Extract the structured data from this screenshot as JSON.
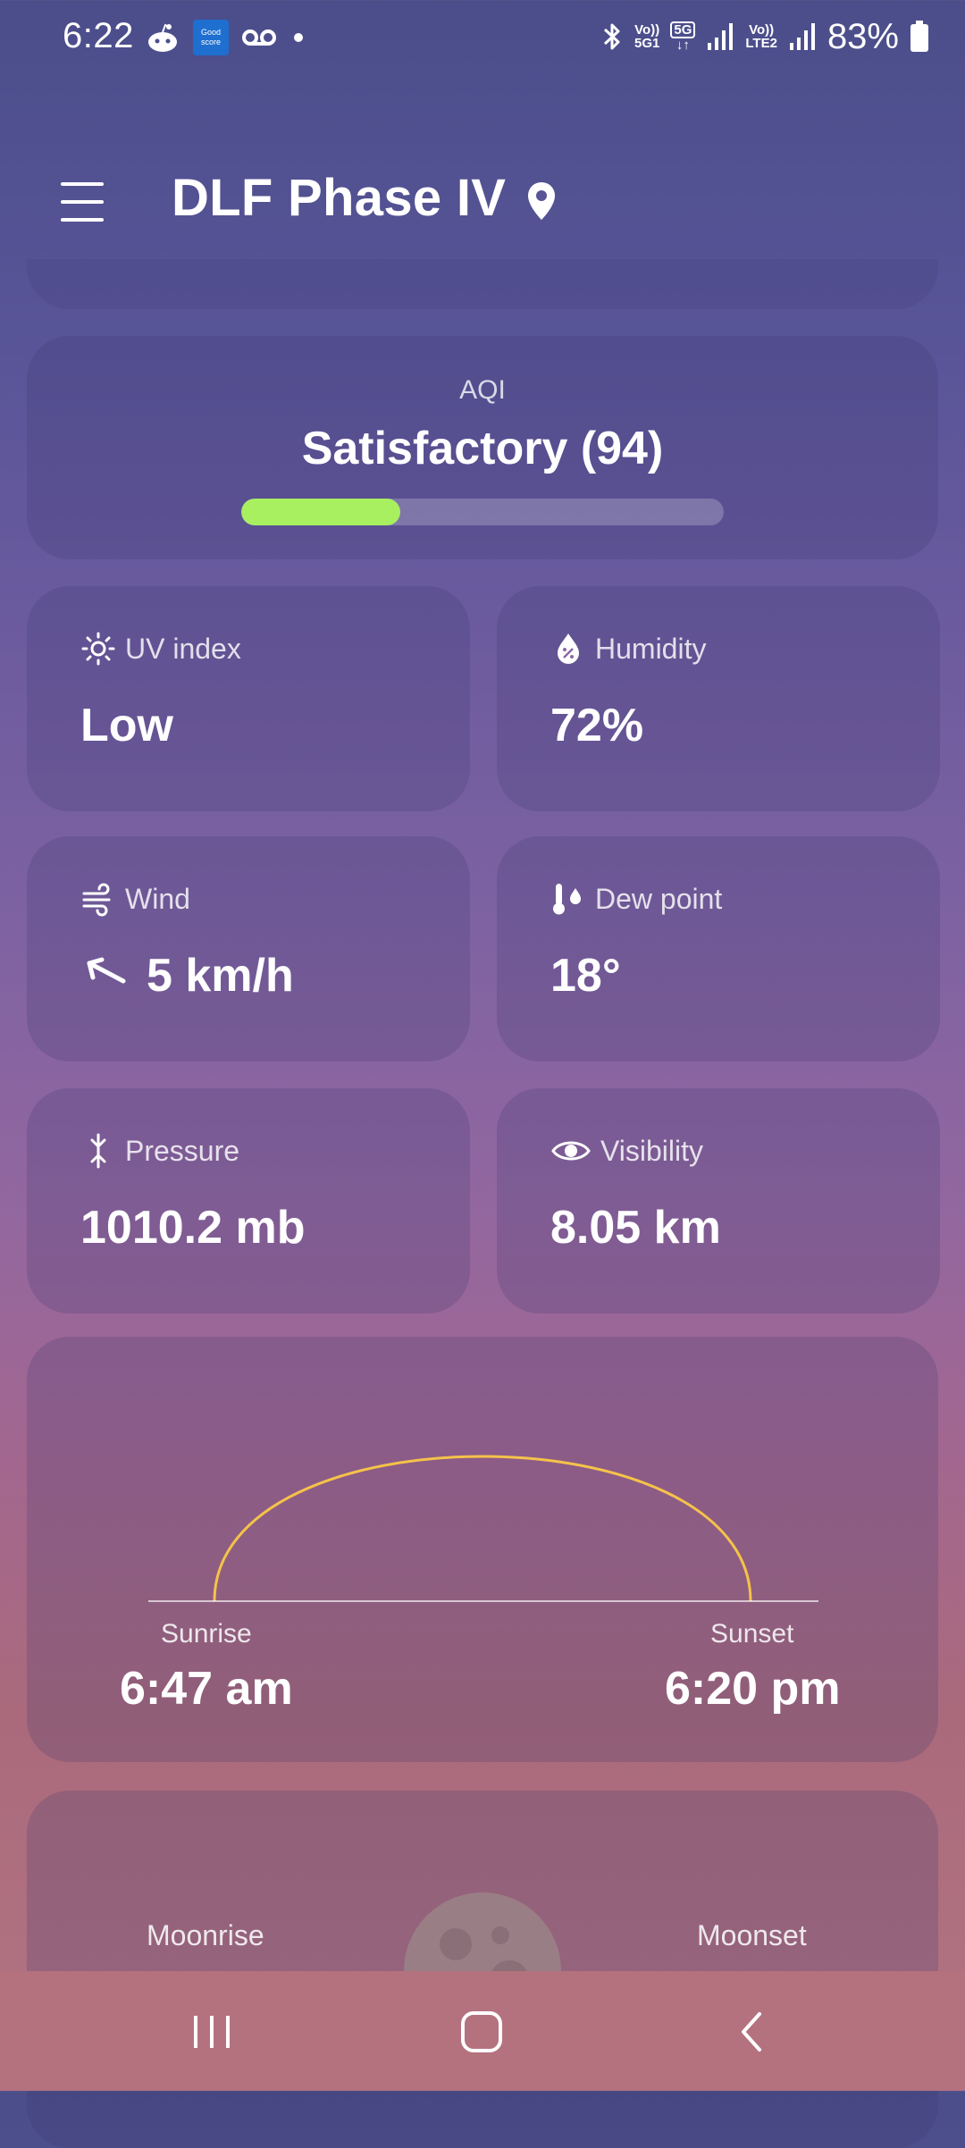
{
  "status_bar": {
    "time": "6:22",
    "battery": "83%",
    "net1_top": "Vo))",
    "net1_bottom": "5G1",
    "net2_top": "5G",
    "net3_top": "Vo))",
    "net3_bottom": "LTE2",
    "left_icons": [
      "reddit-icon",
      "goodscore-app-icon",
      "voicemail-icon",
      "dot-icon"
    ],
    "right_icons": [
      "bluetooth-icon",
      "volte-icon",
      "5g-data-icon",
      "signal-icon",
      "signal-icon",
      "battery-icon"
    ]
  },
  "app_bar": {
    "location": "DLF Phase IV",
    "menu_icon": "hamburger-icon",
    "location_icon": "pin-icon"
  },
  "aqi": {
    "label": "AQI",
    "value": "Satisfactory (94)",
    "level_fraction": 0.33,
    "fill_color": "#a8f060"
  },
  "tiles": [
    {
      "label": "UV index",
      "value": "Low",
      "icon": "sun-icon"
    },
    {
      "label": "Humidity",
      "value": "72%",
      "icon": "droplet-icon"
    },
    {
      "label": "Wind",
      "value": "5 km/h",
      "icon": "wind-icon",
      "value_icon": "wind-direction-arrow-icon"
    },
    {
      "label": "Dew point",
      "value": "18°",
      "icon": "thermometer-drop-icon"
    },
    {
      "label": "Pressure",
      "value": "1010.2 mb",
      "icon": "pressure-icon"
    },
    {
      "label": "Visibility",
      "value": "8.05 km",
      "icon": "eye-icon"
    }
  ],
  "sun": {
    "sunrise_label": "Sunrise",
    "sunrise_time": "6:47 am",
    "sunset_label": "Sunset",
    "sunset_time": "6:20 pm",
    "arc_color": "#f5c24a"
  },
  "moon": {
    "moonrise_label": "Moonrise",
    "moonset_label": "Moonset"
  },
  "nav": {
    "recents_icon": "recents-icon",
    "home_icon": "home-icon",
    "back_icon": "back-icon"
  }
}
